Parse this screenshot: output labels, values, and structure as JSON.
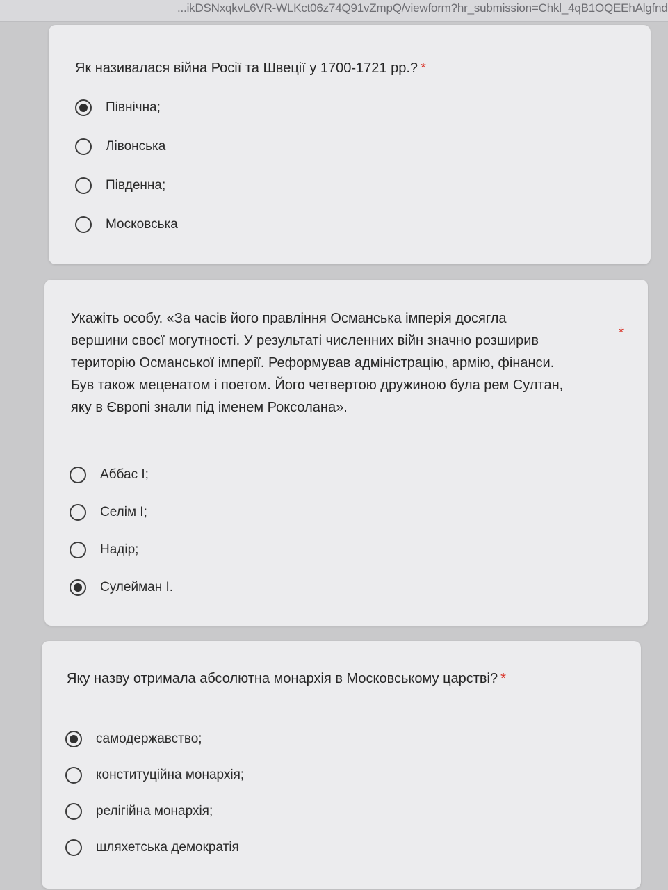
{
  "browser": {
    "url": "...ikDSNxqkvL6VR-WLKct06z74Q91vZmpQ/viewform?hr_submission=Chkl_4qB1OQEEhAlgfnd"
  },
  "required_mark": "*",
  "questions": [
    {
      "title": "Як називалася війна Росії та Швеції у 1700-1721 рр.?",
      "options": [
        {
          "label": "Північна;",
          "selected": true
        },
        {
          "label": "Лівонська",
          "selected": false
        },
        {
          "label": "Південна;",
          "selected": false
        },
        {
          "label": "Московська",
          "selected": false
        }
      ]
    },
    {
      "title_lines": [
        "Укажіть особу. «За часів його правління Османська імперія досягла",
        "вершини своєї могутності. У результаті численних війн значно розширив",
        "територію Османської імперії. Реформував адміністрацію, армію, фінанси.",
        "Був також меценатом і поетом. Його четвертою дружиною була рем Султан,",
        "яку в Європі знали під іменем Роксолана»."
      ],
      "options": [
        {
          "label": "Аббас I;",
          "selected": false
        },
        {
          "label": "Селім I;",
          "selected": false
        },
        {
          "label": "Надір;",
          "selected": false
        },
        {
          "label": "Сулейман I.",
          "selected": true
        }
      ]
    },
    {
      "title": "Яку назву отримала абсолютна монархія в Московському царстві?",
      "options": [
        {
          "label": "самодержавство;",
          "selected": true
        },
        {
          "label": "конституційна монархія;",
          "selected": false
        },
        {
          "label": "релігійна монархія;",
          "selected": false
        },
        {
          "label": "шляхетська демократія",
          "selected": false
        }
      ]
    }
  ]
}
